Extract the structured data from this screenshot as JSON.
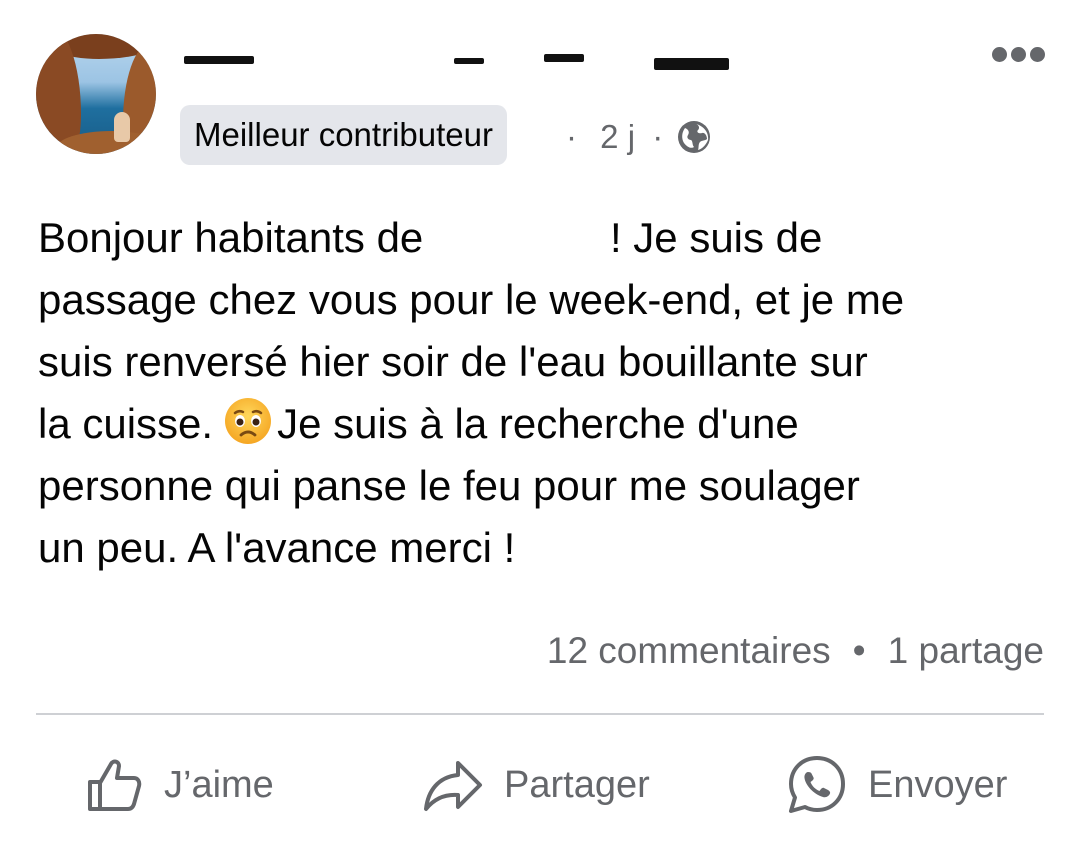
{
  "post": {
    "badge": "Meilleur contributeur",
    "meta_sep1": "·",
    "time": "2 j",
    "meta_sep2": "·",
    "body_lines": {
      "l1_before": "Bonjour habitants de ",
      "l1_after": "! Je suis de",
      "l2": "passage chez vous pour le week-end, et je me",
      "l3": "suis renversé hier soir de l'eau bouillante sur",
      "l4_before": "la cuisse.",
      "l4_after": "Je suis à la recherche d'une",
      "l5": "personne qui panse le feu pour me soulager",
      "l6": "un peu. A l'avance merci !"
    },
    "comments_count": "12 commentaires",
    "counts_sep": "•",
    "shares_count": "1 partage"
  },
  "actions": {
    "like": "J’aime",
    "share": "Partager",
    "send": "Envoyer"
  },
  "icons": {
    "more": "more-options-icon",
    "audience": "globe-icon",
    "emoji": "worried-face-emoji",
    "like": "thumbs-up-icon",
    "share": "share-arrow-icon",
    "send": "whatsapp-icon"
  },
  "colors": {
    "text": "#050505",
    "secondary": "#65676b",
    "badge_bg": "#e4e6eb",
    "divider": "#ced0d4"
  }
}
